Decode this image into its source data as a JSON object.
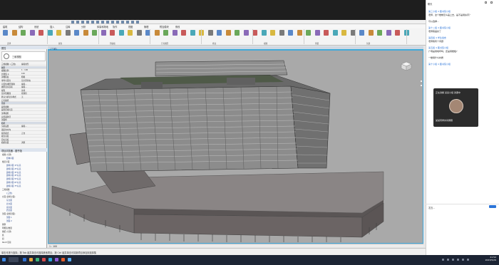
{
  "revit": {
    "ribbon_tabs": [
      "建筑",
      "结构",
      "系统",
      "插入",
      "注释",
      "分析",
      "体量和场地",
      "协作",
      "视图",
      "管理",
      "附加模块",
      "修改"
    ],
    "panel_labels": [
      "选择",
      "属性",
      "剪贴板",
      "几何图形",
      "修改",
      "视图",
      "测量",
      "创建"
    ],
    "properties": {
      "header": "属性",
      "type_name": "三维视图",
      "rows": [
        {
          "k": "三维视图: {三维}",
          "v": "编辑类型"
        },
        {
          "k": "图形",
          "v": "",
          "group": true
        },
        {
          "k": "视图比例",
          "v": "1 : 100"
        },
        {
          "k": "比例值 1:",
          "v": "100"
        },
        {
          "k": "详细程度",
          "v": "粗略"
        },
        {
          "k": "零件可见性",
          "v": "显示原状态"
        },
        {
          "k": "可见性/图形替换",
          "v": "编辑..."
        },
        {
          "k": "图形显示选项",
          "v": "编辑..."
        },
        {
          "k": "规程",
          "v": "协调"
        },
        {
          "k": "显示隐藏线",
          "v": "按规程"
        },
        {
          "k": "默认分析显示样式",
          "v": "无"
        },
        {
          "k": "日光路径",
          "v": ""
        },
        {
          "k": "范围",
          "v": "",
          "group": true
        },
        {
          "k": "裁剪视图",
          "v": ""
        },
        {
          "k": "裁剪区域可见",
          "v": ""
        },
        {
          "k": "注释裁剪",
          "v": ""
        },
        {
          "k": "远剪裁激活",
          "v": ""
        },
        {
          "k": "剖面框",
          "v": ""
        },
        {
          "k": "相机",
          "v": "",
          "group": true
        },
        {
          "k": "渲染设置",
          "v": "编辑..."
        },
        {
          "k": "锁定的方向",
          "v": ""
        },
        {
          "k": "投影模式",
          "v": "正交"
        },
        {
          "k": "视点高度",
          "v": ""
        },
        {
          "k": "目标高度",
          "v": ""
        },
        {
          "k": "相机位置",
          "v": "调整"
        }
      ]
    },
    "browser": {
      "header": "项目浏览器 - 图书馆",
      "items": [
        {
          "t": "视图 (全部)",
          "plain": true
        },
        {
          "t": "结构平面"
        },
        {
          "t": "楼层平面",
          "plain": true
        },
        {
          "t": "建筑平面 1F 标高"
        },
        {
          "t": "建筑平面 2F 标高"
        },
        {
          "t": "建筑平面 3F 标高"
        },
        {
          "t": "建筑平面 4F 标高"
        },
        {
          "t": "建筑平面 5F 标高"
        },
        {
          "t": "建筑平面 6F 标高"
        },
        {
          "t": "建筑平面 7F 标高"
        },
        {
          "t": "三维视图",
          "plain": true
        },
        {
          "t": "{三维}"
        },
        {
          "t": "立面 (建筑立面)",
          "plain": true
        },
        {
          "t": "东立面"
        },
        {
          "t": "北立面"
        },
        {
          "t": "南立面"
        },
        {
          "t": "西立面"
        },
        {
          "t": "剖面 (建筑剖面)",
          "plain": true
        },
        {
          "t": "剖面 1"
        },
        {
          "t": "剖面 2"
        },
        {
          "t": "图例",
          "plain": true
        },
        {
          "t": "明细表/数量",
          "plain": true
        },
        {
          "t": "图纸 (全部)",
          "plain": true
        },
        {
          "t": "族",
          "plain": true
        },
        {
          "t": "组",
          "plain": true
        },
        {
          "t": "Revit 链接",
          "plain": true
        }
      ]
    },
    "view_tab": "{三维}",
    "view_control": "1 : 100",
    "status": "单击可进行选择；按 Tab 键并单击可选择其他项目；按 Ctrl 键并单击可将新项目添加到选择集"
  },
  "chat": {
    "title": "聊天",
    "messages": [
      {
        "name": "第三小组 4 图书馆小组",
        "text": "老师，这个楼梯怎么画上去，是不是用扶手？"
      },
      {
        "name": "",
        "text": "可以选择..."
      },
      {
        "name": "第十二组 4 图书馆小组",
        "text": "老师我画好了"
      },
      {
        "name": "第四组 4 学生宿舍",
        "text": "老师我有个问题"
      },
      {
        "name": "第五组 4 图书馆小组",
        "text": "广场是用地坪吗，还是用楼板?"
      },
      {
        "name": "",
        "text": "一楼用什么材质"
      },
      {
        "name": "第十小组 4 图书馆小组",
        "text": ""
      }
    ],
    "video_title": "正在讲解 某某小组 讲课中",
    "video_name": "某某同学共享屏幕",
    "input_placeholder": "发言...",
    "colors": {
      "name": "#2b74d8",
      "accent": "#2b74d8"
    }
  },
  "taskbar": {
    "time": "21:52",
    "date": "2023/5/29"
  }
}
